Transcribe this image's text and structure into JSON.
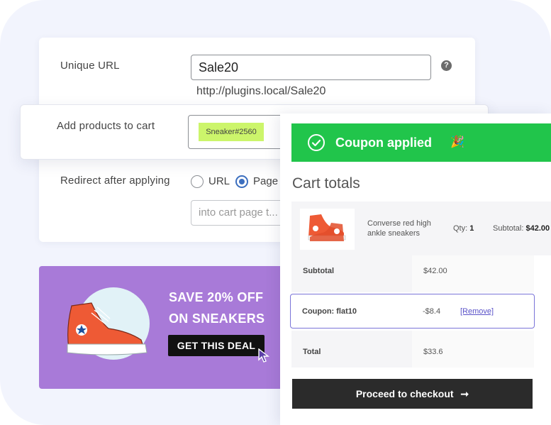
{
  "settings": {
    "unique_url_label": "Unique URL",
    "url_value": "Sale20",
    "help_icon": "?",
    "url_preview": "http://plugins.local/Sale20",
    "add_products_label": "Add products to cart",
    "product_tag": "Sneaker#2560",
    "redirect_label": "Redirect after applying",
    "redirect_options": [
      "URL",
      "Page"
    ],
    "redirect_selected": "Page",
    "redirect_placeholder": "into cart page t..."
  },
  "promo": {
    "line1": "SAVE 20% OFF",
    "line2": "ON SNEAKERS",
    "button": "GET THIS DEAL"
  },
  "cart": {
    "banner_text": "Coupon applied",
    "banner_emoji": "🎉",
    "title": "Cart totals",
    "product": {
      "name": "Converse red high ankle sneakers",
      "qty_label": "Qty:",
      "qty": "1",
      "subtotal_label": "Subtotal:",
      "subtotal": "$42.00"
    },
    "rows": [
      {
        "label": "Subtotal",
        "value": "$42.00"
      },
      {
        "label": "Coupon: flat10",
        "value": "-$8.4",
        "link": "[Remove]"
      },
      {
        "label": "Total",
        "value": "$33.6"
      }
    ],
    "checkout_label": "Proceed to checkout",
    "checkout_arrow": "➞"
  },
  "colors": {
    "accent_green": "#21c54b",
    "promo_purple": "#a87ad8",
    "tag_lime": "#ccf56b",
    "highlight_purple": "#7a74d8"
  }
}
